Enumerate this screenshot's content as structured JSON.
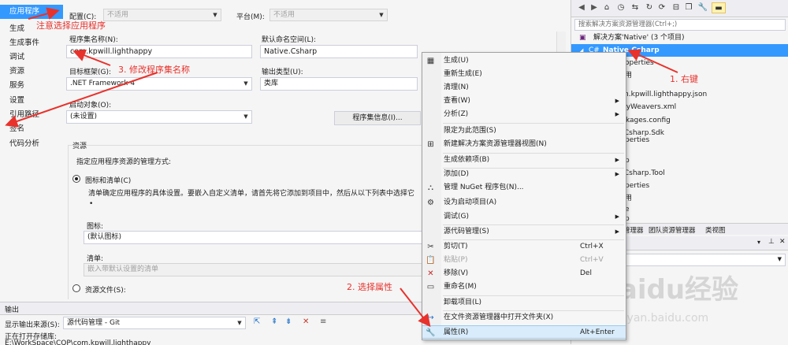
{
  "sidebar": {
    "items": [
      "应用程序",
      "生成",
      "生成事件",
      "调试",
      "资源",
      "服务",
      "设置",
      "引用路径",
      "签名",
      "代码分析"
    ]
  },
  "config": {
    "config_label": "配置(C):",
    "config_value": "不适用",
    "platform_label": "平台(M):",
    "platform_value": "不适用"
  },
  "form": {
    "assembly_name_label": "程序集名称(N):",
    "assembly_name_value": "com.kpwill.lighthappy",
    "namespace_label": "默认命名空间(L):",
    "namespace_value": "Native.Csharp",
    "target_framework_label": "目标框架(G):",
    "target_framework_value": ".NET Framework 4",
    "output_type_label": "输出类型(U):",
    "output_type_value": "类库",
    "startup_label": "启动对象(O):",
    "startup_value": "(未设置)",
    "assembly_info_button": "程序集信息(I)..."
  },
  "resources": {
    "group_title": "资源",
    "description": "指定应用程序资源的管理方式:",
    "option_icon_manifest": "图标和清单(C)",
    "option_desc": "清单确定应用程序的具体设置。要嵌入自定义清单，请首先将它添加到项目中，然后从以下列表中选择它",
    "bullet": "•",
    "icon_label": "图标:",
    "icon_value": "(默认图标)",
    "manifest_label": "清单:",
    "manifest_value": "嵌入带默认设置的清单",
    "option_resource_file": "资源文件(S):"
  },
  "annotations": {
    "step_select_app": "注意选择应用程序",
    "step3": "3. 修改程序集名称",
    "step1": "1. 右键",
    "step2": "2. 选择属性"
  },
  "solution_explorer": {
    "search_placeholder": "搜索解决方案资源管理器(Ctrl+;)",
    "solution_line": "解决方案'Native' (3 个项目)",
    "selected_project": "Native.Csharp",
    "rows": [
      "operties",
      "用",
      "m.kpwill.lighthappy.json",
      "dyWeavers.xml",
      "ckages.config",
      ".Csharp.Sdk",
      "perties",
      "",
      "p",
      ".Csharp.Tool",
      "perties",
      "用",
      "e",
      "p"
    ],
    "tabs": [
      "管理器",
      "团队资源管理器",
      "类视图"
    ]
  },
  "output": {
    "title": "输出",
    "source_label": "显示输出来源(S):",
    "source_value": "源代码管理 - Git",
    "line1": "正在打开存储库:",
    "line2": "E:\\WorkSpace\\CQP\\com.kpwill.lighthappy"
  },
  "context_menu": {
    "items": [
      {
        "label": "生成(U)",
        "icon": "build-icon"
      },
      {
        "label": "重新生成(E)"
      },
      {
        "label": "清理(N)"
      },
      {
        "label": "查看(W)",
        "submenu": true
      },
      {
        "label": "分析(Z)",
        "submenu": true
      },
      {
        "label": "限定为此范围(S)"
      },
      {
        "label": "新建解决方案资源管理器视图(N)",
        "icon": "new-view-icon"
      },
      {
        "label": "生成依赖项(B)",
        "submenu": true
      },
      {
        "label": "添加(D)",
        "submenu": true
      },
      {
        "label": "管理 NuGet 程序包(N)...",
        "icon": "nuget-icon"
      },
      {
        "label": "设为启动项目(A)",
        "icon": "gear-icon"
      },
      {
        "label": "调试(G)",
        "submenu": true
      },
      {
        "label": "源代码管理(S)",
        "submenu": true
      },
      {
        "label": "剪切(T)",
        "shortcut": "Ctrl+X",
        "icon": "scissors-icon"
      },
      {
        "label": "粘贴(P)",
        "shortcut": "Ctrl+V",
        "disabled": true,
        "icon": "paste-icon"
      },
      {
        "label": "移除(V)",
        "shortcut": "Del",
        "icon": "remove-icon"
      },
      {
        "label": "重命名(M)",
        "icon": "rename-icon"
      },
      {
        "label": "卸载项目(L)"
      },
      {
        "label": "在文件资源管理器中打开文件夹(X)",
        "icon": "folder-arrow-icon"
      },
      {
        "label": "属性(R)",
        "shortcut": "Alt+Enter",
        "icon": "wrench-icon",
        "highlighted": true
      }
    ]
  },
  "watermark": {
    "brand": "Baidu经验",
    "url": "jingyan.baidu.com"
  },
  "colors": {
    "accent": "#3399ff",
    "annotation": "#e8322c",
    "selection": "#3399ff",
    "menu_highlight": "#d9ecfb"
  }
}
